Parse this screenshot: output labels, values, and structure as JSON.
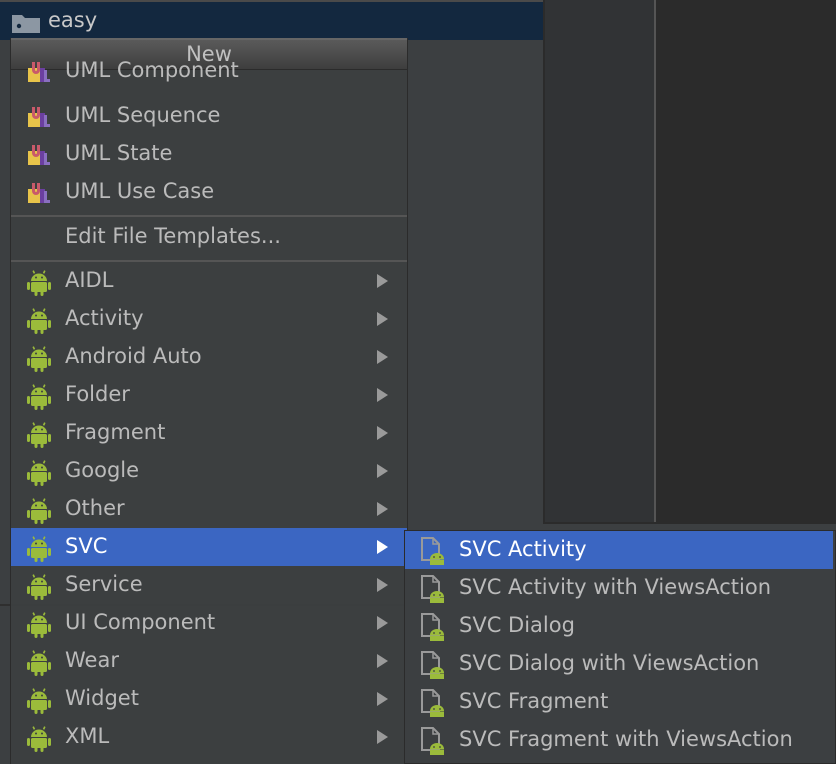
{
  "project_tree": {
    "selected_folder": "easy"
  },
  "menu": {
    "title": "New",
    "uml_items": [
      {
        "label": "UML Component",
        "icon": "uml-icon"
      },
      {
        "label": "UML Sequence",
        "icon": "uml-icon"
      },
      {
        "label": "UML State",
        "icon": "uml-icon"
      },
      {
        "label": "UML Use Case",
        "icon": "uml-icon"
      }
    ],
    "edit_templates": "Edit File Templates...",
    "android_items": [
      {
        "label": "AIDL"
      },
      {
        "label": "Activity"
      },
      {
        "label": "Android Auto"
      },
      {
        "label": "Folder"
      },
      {
        "label": "Fragment"
      },
      {
        "label": "Google"
      },
      {
        "label": "Other"
      },
      {
        "label": "SVC",
        "selected": true
      },
      {
        "label": "Service"
      },
      {
        "label": "UI Component"
      },
      {
        "label": "Wear"
      },
      {
        "label": "Widget"
      },
      {
        "label": "XML"
      }
    ]
  },
  "submenu": {
    "items": [
      {
        "label": "SVC Activity",
        "selected": true
      },
      {
        "label": "SVC Activity with ViewsAction"
      },
      {
        "label": "SVC Dialog"
      },
      {
        "label": "SVC Dialog with ViewsAction"
      },
      {
        "label": "SVC Fragment"
      },
      {
        "label": "SVC Fragment with ViewsAction"
      }
    ]
  },
  "colors": {
    "selection": "#3b66c2",
    "android_green": "#9bbb3b",
    "menu_bg": "#3c3f41",
    "tree_selection": "#13283f"
  }
}
